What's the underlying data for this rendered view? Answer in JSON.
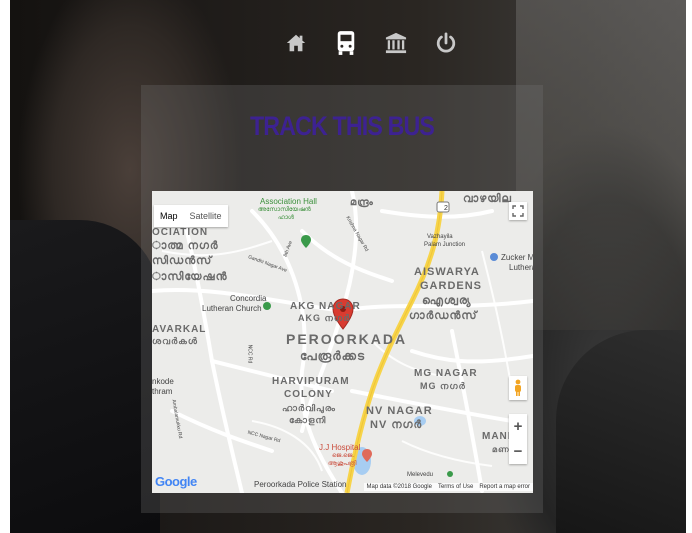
{
  "nav": {
    "home_icon": "home-icon",
    "bus_icon": "bus-icon",
    "bank_icon": "institution-icon",
    "power_icon": "power-icon",
    "icon_color": "#c8c8c8",
    "active_icon_color": "#ffffff"
  },
  "panel": {
    "title": "TRACK THIS BUS",
    "title_color": "#3d2291"
  },
  "map": {
    "map_type": {
      "map_label": "Map",
      "satellite_label": "Satellite"
    },
    "labels": {
      "association_hall": "Association Hall",
      "association_hall_ml": "അസോസിയേഷൻ",
      "association_hall_ml2": "ഹാൾ",
      "manthrom": "മന്ദ്രം",
      "vazhayila": "വാഴയില",
      "vazhayila_palam": "Vazhayila",
      "palam_junction": "Palam Junction",
      "zucker": "Zucker M",
      "lutheran_r": "Lutheran",
      "association_left": "OCIATION",
      "nagar_ml_left": "ാത്മ നഗർ",
      "sidans_ml": "സിഡൻസ്",
      "association_ml_left": "ാസിയേഷൻ",
      "aiswarya": "AISWARYA",
      "gardens": "GARDENS",
      "aiswarya_ml": "ഐശ്വര്യ",
      "gardens_ml": "ഗാർഡൻസ്",
      "concordia": "Concordia",
      "lutheran_church": "Lutheran Church",
      "akg_nagar": "AKG NAGAR",
      "akg_ml": "AKG നഗർ",
      "peroorkada": "PEROORKADA",
      "peroorkada_ml": "പേരൂർക്കട",
      "avarkal": "AVARKAL",
      "avarkal_ml": "ശവർകൾ",
      "harvipuram": "HARVIPURAM",
      "colony": "COLONY",
      "harvipuram_ml": "ഹാർവിപുരം",
      "colony_ml": "കോളനി",
      "mg_nagar": "MG NAGAR",
      "mg_nagar_ml": "MG നഗർ",
      "nv_nagar": "NV NAGAR",
      "nv_nagar_ml": "NV നഗർ",
      "nkode": "nkode",
      "thram": "thram",
      "jj_hospital": "J.J Hospital",
      "jj_ml": "ജെ.ജെ.",
      "jj_ml2": "ആശുപത്രി",
      "manik": "MANIK",
      "manik_ml": "മണ",
      "police_station": "Peroorkada Police Station",
      "melevedu": "Melevedu",
      "road_gandhi": "Gandhi Nagar Ave",
      "road_krishna": "Krishna Nagar Rd",
      "road_ncc": "NCC Rd",
      "road_ncc2": "NCC Nagar Rd",
      "road_ambalam": "Ambalamukku Rd",
      "road_8th": "8th Ave",
      "highway": "2"
    },
    "logo": "Google",
    "attribution": {
      "map_data": "Map data ©2018 Google",
      "terms": "Terms of Use",
      "report": "Report a map error"
    },
    "fullscreen_icon": "fullscreen-icon",
    "pegman_icon": "pegman-icon",
    "zoom_in": "+",
    "zoom_out": "−",
    "marker_color": "#d93b30"
  }
}
